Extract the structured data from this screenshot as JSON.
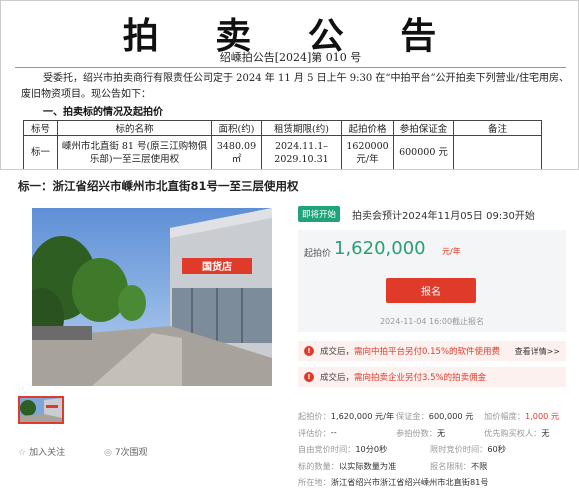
{
  "notice": {
    "title": "拍 卖 公 告",
    "number": "绍嵊拍公告[2024]第 010 号",
    "body": "受委托，绍兴市拍卖商行有限责任公司定于 2024 年 11 月 5 日上午 9:30 在“中拍平台”公开拍卖下列营业/住宅用房、废旧物资项目。现公告如下：",
    "section": "一、拍卖标的情况及起拍价",
    "table": {
      "headers": [
        "标号",
        "标的名称",
        "面积(约)",
        "租赁期限(约)",
        "起拍价格",
        "参拍保证金",
        "备注"
      ],
      "row": {
        "no": "标一",
        "name": "嵊州市北直街 81 号(原三江购物俱乐部)一至三层使用权",
        "area": "3480.09㎡",
        "term": "2024.11.1–2029.10.31",
        "price": "1620000元/年",
        "deposit": "600000 元",
        "remark": ""
      }
    }
  },
  "listing": {
    "title": "标一：浙江省绍兴市嵊州市北直街81号一至三层使用权",
    "photo_sign": "国货店",
    "actions": {
      "follow": "加入关注",
      "views": "7次围观"
    },
    "status_badge": "即将开始",
    "status_text": "拍卖会预计2024年11月05日  09:30开始",
    "start_label": "起拍价",
    "start_price": "1,620,000",
    "start_unit": "元/年",
    "signup_button": "报名",
    "deadline": "2024-11-04 16:00截止报名",
    "alerts": [
      {
        "prefix": "成交后，",
        "highlight": "需向中拍平台另付0.15%的软件使用费",
        "link": "查看详情>>"
      },
      {
        "prefix": "成交后，",
        "highlight": "需向拍卖企业另付3.5%的拍卖佣金",
        "link": ""
      }
    ],
    "info": [
      [
        {
          "label": "起拍价：",
          "value": "1,620,000 元/年",
          "red": false
        },
        {
          "label": "保证金：",
          "value": "600,000 元",
          "red": false
        },
        {
          "label": "加价幅度：",
          "value": "1,000 元",
          "red": true
        }
      ],
      [
        {
          "label": "评估价：",
          "value": "--",
          "red": false
        },
        {
          "label": "参拍份数：",
          "value": "无",
          "red": false
        },
        {
          "label": "优先购买权人：",
          "value": "无",
          "red": false
        }
      ],
      [
        {
          "label": "自由竞价时间：",
          "value": "10分0秒",
          "red": false
        },
        {
          "label": "限时竞价时间：",
          "value": "60秒",
          "red": false
        }
      ],
      [
        {
          "label": "标的数量：",
          "value": "以实际数量为准",
          "red": false
        },
        {
          "label": "报名限制：",
          "value": "不限",
          "red": false
        }
      ],
      [
        {
          "label": "所在地：",
          "value": "浙江省绍兴市浙江省绍兴嵊州市北直街81号",
          "red": false
        }
      ]
    ],
    "colors": {
      "accent_red": "#e03b2a",
      "accent_green": "#1fa37a",
      "price_green": "#2b9e75"
    },
    "icons": [
      "star-icon",
      "eye-icon",
      "warning-icon"
    ]
  }
}
